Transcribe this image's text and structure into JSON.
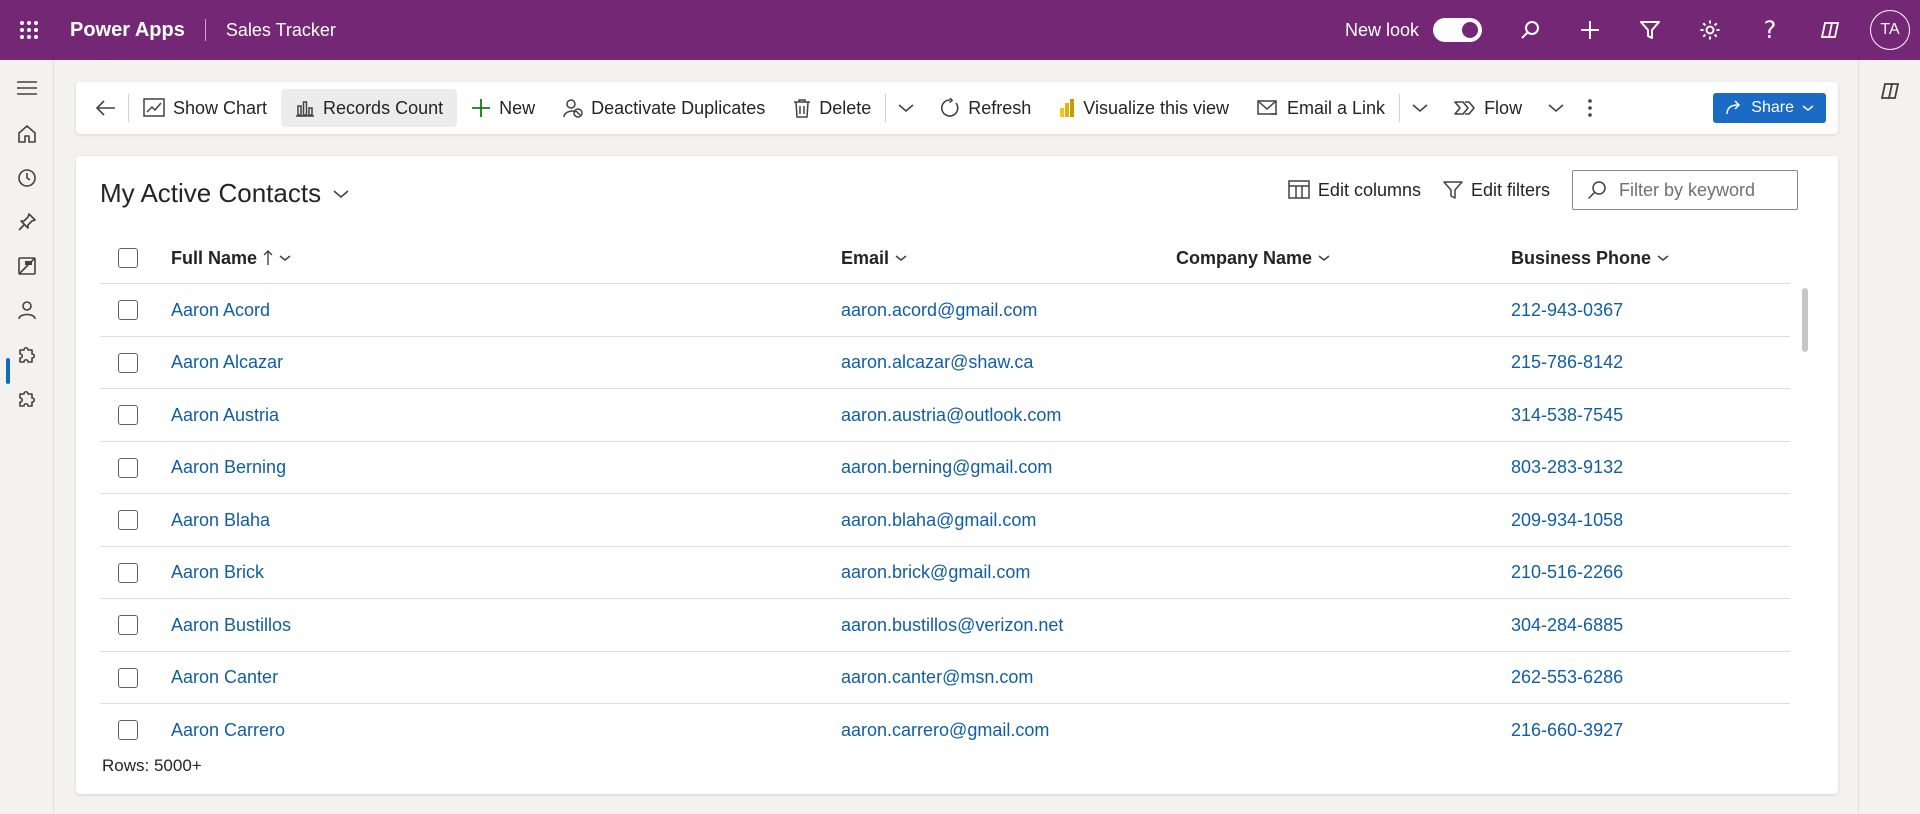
{
  "topbar": {
    "app_name": "Power Apps",
    "environment": "Sales Tracker",
    "new_look_label": "New look",
    "new_look_enabled": true,
    "avatar_initials": "TA",
    "brand_color": "#742774"
  },
  "leftnav": {
    "items": [
      "menu-icon",
      "home-icon",
      "recent-icon",
      "pin-icon",
      "entity-icon",
      "contacts-icon",
      "puzzle-icon",
      "puzzle-icon-2"
    ],
    "active": "contacts-icon"
  },
  "commandbar": {
    "back_icon": "back-arrow-icon",
    "show_chart": "Show Chart",
    "records_count": "Records Count",
    "new": "New",
    "deactivate_duplicates": "Deactivate Duplicates",
    "delete": "Delete",
    "refresh": "Refresh",
    "visualize": "Visualize this view",
    "email_link": "Email a Link",
    "flow": "Flow",
    "share": "Share"
  },
  "view": {
    "title": "My Active Contacts",
    "edit_columns": "Edit columns",
    "edit_filters": "Edit filters",
    "filter_placeholder": "Filter by keyword"
  },
  "grid": {
    "columns": {
      "full_name": "Full Name",
      "email": "Email",
      "company": "Company Name",
      "phone": "Business Phone"
    },
    "sort": {
      "column": "full_name",
      "direction": "ascending"
    },
    "rows": [
      {
        "name": "Aaron Acord",
        "email": "aaron.acord@gmail.com",
        "company": "",
        "phone": "212-943-0367"
      },
      {
        "name": "Aaron Alcazar",
        "email": "aaron.alcazar@shaw.ca",
        "company": "",
        "phone": "215-786-8142"
      },
      {
        "name": "Aaron Austria",
        "email": "aaron.austria@outlook.com",
        "company": "",
        "phone": "314-538-7545"
      },
      {
        "name": "Aaron Berning",
        "email": "aaron.berning@gmail.com",
        "company": "",
        "phone": "803-283-9132"
      },
      {
        "name": "Aaron Blaha",
        "email": "aaron.blaha@gmail.com",
        "company": "",
        "phone": "209-934-1058"
      },
      {
        "name": "Aaron Brick",
        "email": "aaron.brick@gmail.com",
        "company": "",
        "phone": "210-516-2266"
      },
      {
        "name": "Aaron Bustillos",
        "email": "aaron.bustillos@verizon.net",
        "company": "",
        "phone": "304-284-6885"
      },
      {
        "name": "Aaron Canter",
        "email": "aaron.canter@msn.com",
        "company": "",
        "phone": "262-553-6286"
      },
      {
        "name": "Aaron Carrero",
        "email": "aaron.carrero@gmail.com",
        "company": "",
        "phone": "216-660-3927"
      }
    ],
    "rows_count": "Rows: 5000+"
  }
}
